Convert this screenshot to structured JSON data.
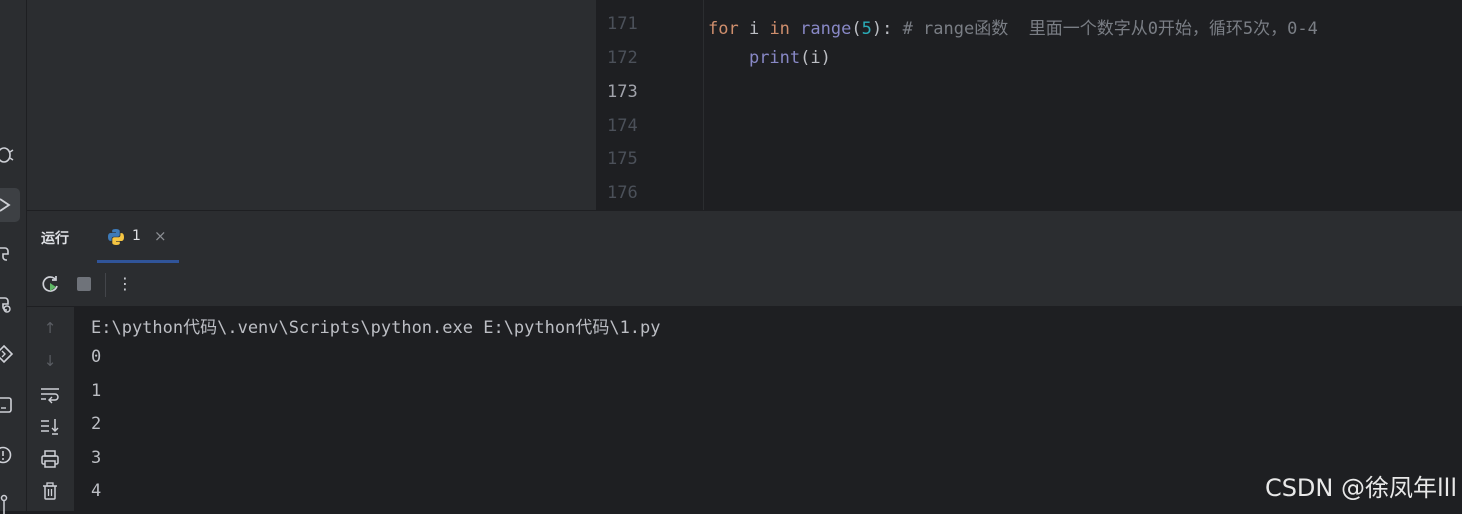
{
  "left_strip": {
    "icons": [
      "bug-icon",
      "run-icon",
      "python-packages-icon",
      "python-console-icon",
      "services-icon",
      "terminal-icon",
      "problems-icon",
      "git-icon"
    ]
  },
  "editor": {
    "line_numbers": [
      "171",
      "172",
      "173",
      "174",
      "175",
      "176"
    ],
    "current_line": "173",
    "line171": {
      "kw_for": "for",
      "var_i": " i ",
      "kw_in": "in",
      "space": " ",
      "fn_range": "range",
      "paren_open": "(",
      "num": "5",
      "paren_close": "):",
      "comment": " # range函数  里面一个数字从0开始，循环5次，0-4"
    },
    "line172": {
      "indent": "    ",
      "fn_print": "print",
      "args": "(i)"
    }
  },
  "run_panel": {
    "title": "运行",
    "tab_label": "1",
    "tab_close": "×"
  },
  "toolbar": {
    "rerun_icon": "↻",
    "stop_icon": "■",
    "more_icon": "⋮"
  },
  "console": {
    "lines": [
      "E:\\python代码\\.venv\\Scripts\\python.exe E:\\python代码\\1.py",
      "0",
      "1",
      "2",
      "3",
      "4"
    ]
  },
  "console_gutter": {
    "up": "↑",
    "down": "↓",
    "wrap": "⤶",
    "scroll_end": "⇊",
    "print": "⎙",
    "trash": "🗑"
  },
  "watermark": "CSDN @徐凤年lll"
}
